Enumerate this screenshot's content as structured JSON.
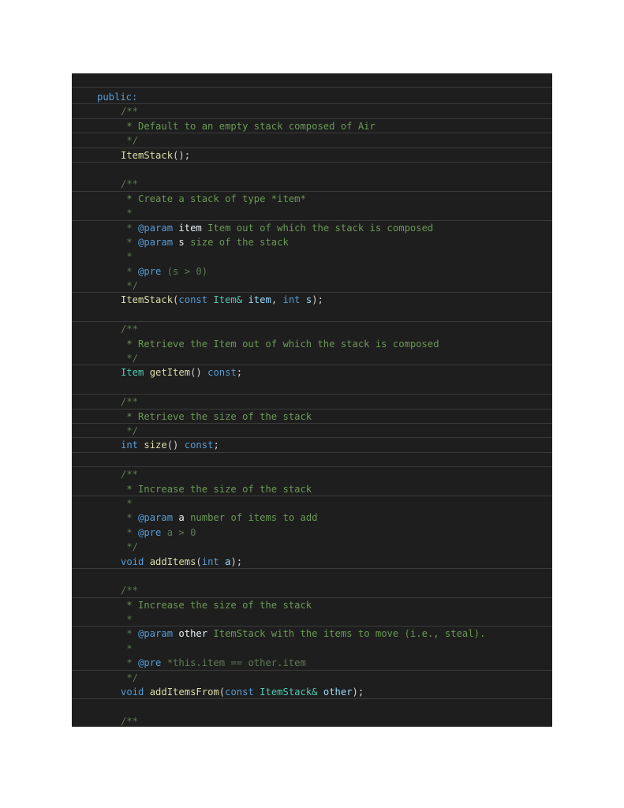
{
  "code": {
    "access_specifier": "public:",
    "blocks": [
      {
        "doc_open": "/**",
        "summary": " * Default to an empty stack composed of Air",
        "doc_close": " */",
        "declaration": {
          "name": "ItemStack",
          "tail": "();"
        }
      },
      {
        "doc_open": "/**",
        "summary": " * Create a stack of type *item*",
        "blank": " *",
        "params": [
          {
            "prefix": " * ",
            "tag": "@param",
            "name": "item",
            "desc": "Item out of which the stack is composed"
          },
          {
            "prefix": " * ",
            "tag": "@param",
            "name": "s",
            "desc": "size of the stack"
          }
        ],
        "blank2": " *",
        "pre": {
          "prefix": " * ",
          "tag": "@pre",
          "desc": "(s > 0)"
        },
        "doc_close": " */",
        "declaration": {
          "name": "ItemStack",
          "open": "(",
          "kw1": "const",
          "type1": "Item&",
          "var1": "item",
          "comma": ",",
          "kw2": "int",
          "var2": "s",
          "close": ");"
        }
      },
      {
        "doc_open": "/**",
        "summary": " * Retrieve the Item out of which the stack is composed",
        "doc_close": " */",
        "declaration": {
          "ret": "Item",
          "name": "getItem",
          "parens": "()",
          "kw": "const",
          "end": ";"
        }
      },
      {
        "doc_open": "/**",
        "summary": " * Retrieve the size of the stack",
        "doc_close": " */",
        "declaration": {
          "ret": "int",
          "name": "size",
          "parens": "()",
          "kw": "const",
          "end": ";"
        }
      },
      {
        "doc_open": "/**",
        "summary": " * Increase the size of the stack",
        "blank": " *",
        "params": [
          {
            "prefix": " * ",
            "tag": "@param",
            "name": "a",
            "desc": "number of items to add"
          }
        ],
        "pre": {
          "prefix": " * ",
          "tag": "@pre",
          "desc": "a > 0"
        },
        "doc_close": " */",
        "declaration": {
          "ret": "void",
          "name": "addItems",
          "open": "(",
          "kw": "int",
          "var": "a",
          "close": ");"
        }
      },
      {
        "doc_open": "/**",
        "summary": " * Increase the size of the stack",
        "blank": " *",
        "params": [
          {
            "prefix": " * ",
            "tag": "@param",
            "name": "other",
            "desc": "ItemStack with the items to move (i.e., steal)."
          }
        ],
        "blank2": " *",
        "pre": {
          "prefix": " * ",
          "tag": "@pre",
          "desc": "*this.item == other.item"
        },
        "doc_close": " */",
        "declaration": {
          "ret": "void",
          "name": "addItemsFrom",
          "open": "(",
          "kw": "const",
          "type": "ItemStack&",
          "var": "other",
          "close": ");"
        }
      },
      {
        "doc_open": "/**"
      }
    ]
  },
  "colors": {
    "background": "#1e1e1e",
    "keyword": "#569cd6",
    "type": "#4ec9b0",
    "function": "#dcdcaa",
    "variable": "#9cdcfe",
    "comment": "#6a9955"
  }
}
